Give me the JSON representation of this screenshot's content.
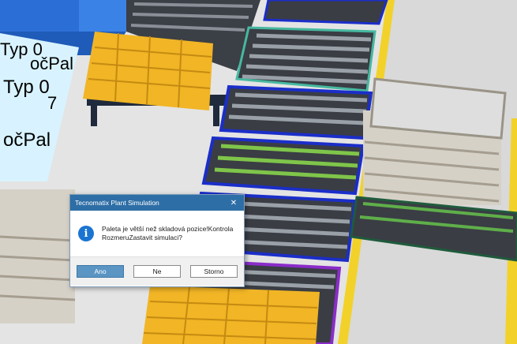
{
  "scene": {
    "labels": [
      "Typ 0",
      "očPal",
      "Typ 0",
      "7",
      "očPal"
    ]
  },
  "dialog": {
    "title": "Tecnomatix Plant Simulation",
    "close_symbol": "✕",
    "icon": "info-icon",
    "icon_glyph": "i",
    "message": "Paleta je větší než skladová pozice!KontrolaRozmeruZastavit simulaci?",
    "buttons": {
      "yes": "Ano",
      "no": "Ne",
      "cancel": "Storno"
    }
  }
}
